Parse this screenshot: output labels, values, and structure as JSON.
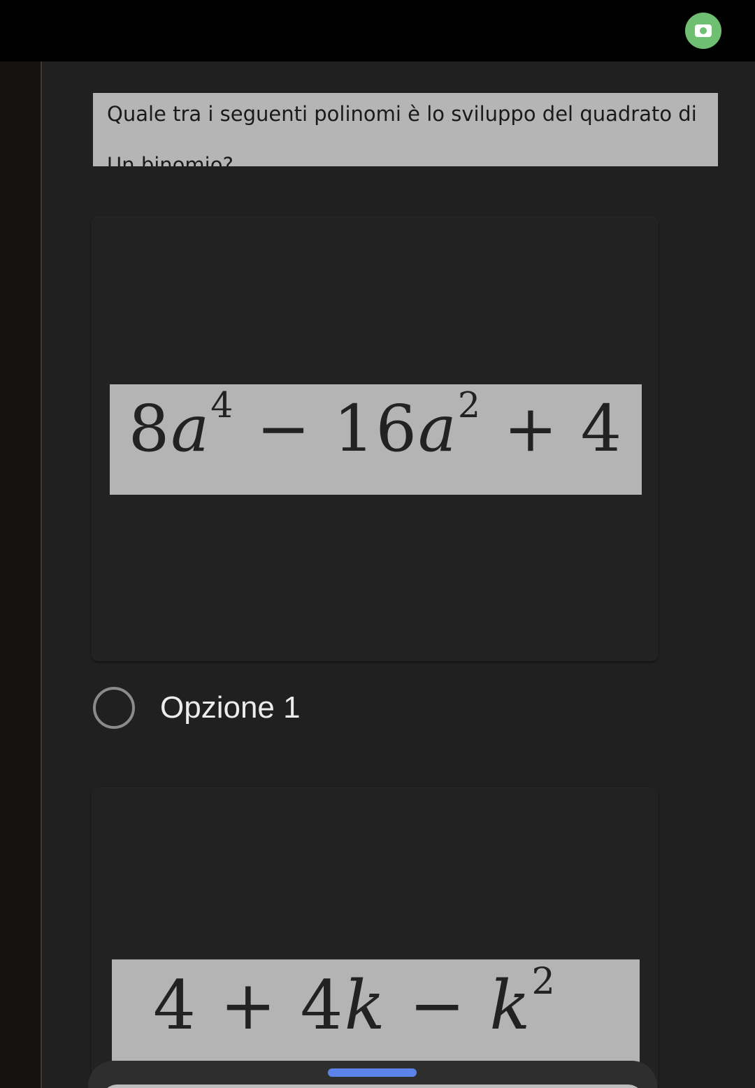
{
  "question": {
    "line1": "Quale tra i seguenti polinomi è lo sviluppo del quadrato di",
    "line2": "Un binomio?"
  },
  "options": [
    {
      "formula": {
        "c1": "8",
        "v1": "a",
        "e1": "4",
        "op1": " − 16",
        "v2": "a",
        "e2": "2",
        "op2": " + 4"
      },
      "label": "Opzione 1",
      "selected": false
    },
    {
      "formula": {
        "t1": "4 + 4",
        "v1": "k",
        "op1": " − ",
        "v2": "k",
        "e2": "2"
      }
    }
  ],
  "colors": {
    "camera_button": "#6fbf73",
    "sheet_handle": "#5b83e8",
    "background": "#202020"
  },
  "icons": {
    "camera": "camera-icon"
  }
}
